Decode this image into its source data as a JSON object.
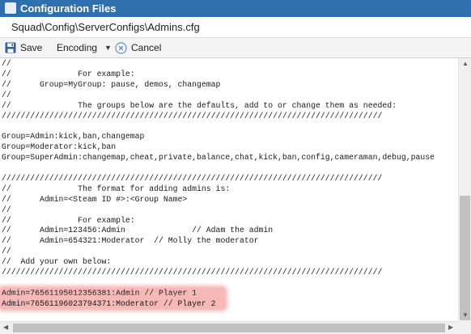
{
  "window": {
    "title": "Configuration Files"
  },
  "path": {
    "text": "Squad\\Config\\ServerConfigs\\Admins.cfg"
  },
  "toolbar": {
    "save_label": "Save",
    "encoding_label": "Encoding",
    "cancel_label": "Cancel"
  },
  "colors": {
    "titlebar": "#2e6fb0",
    "highlight": "#f7b8b8",
    "save_icon": "#2f5f9e",
    "cancel_icon": "#5b8fd0"
  },
  "icons": {
    "window": "app-window-icon",
    "save": "floppy-disk-icon",
    "encoding": "chevron-down-icon",
    "cancel": "cancel-circle-icon"
  },
  "editor": {
    "lines": [
      "//",
      "//              For example:",
      "//      Group=MyGroup: pause, demos, changemap",
      "//",
      "//              The groups below are the defaults, add to or change them as needed:",
      "////////////////////////////////////////////////////////////////////////////////",
      "",
      "Group=Admin:kick,ban,changemap",
      "Group=Moderator:kick,ban",
      "Group=SuperAdmin:changemap,cheat,private,balance,chat,kick,ban,config,cameraman,debug,pause",
      "",
      "////////////////////////////////////////////////////////////////////////////////",
      "//              The format for adding admins is:",
      "//      Admin=<Steam ID #>:<Group Name>",
      "//",
      "//              For example:",
      "//      Admin=123456:Admin              // Adam the admin",
      "//      Admin=654321:Moderator  // Molly the moderator",
      "//",
      "//  Add your own below:",
      "////////////////////////////////////////////////////////////////////////////////",
      "",
      "Admin=76561195012356381:Admin // Player 1",
      "Admin=76561196023794371:Moderator // Player 2",
      ""
    ],
    "highlighted_lines": [
      22,
      23
    ]
  }
}
